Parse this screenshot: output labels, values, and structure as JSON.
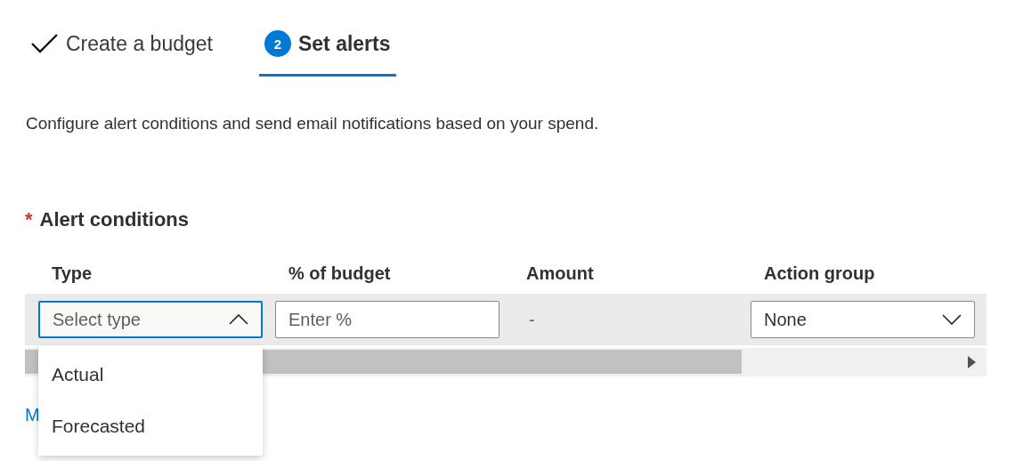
{
  "steps": [
    {
      "label": "Create a budget",
      "kind": "done",
      "selected": false
    },
    {
      "label": "Set alerts",
      "number": "2",
      "kind": "current",
      "selected": true
    }
  ],
  "description": "Configure alert conditions and send email notifications based on your spend.",
  "section": {
    "title": "Alert conditions",
    "required": true,
    "required_mark": "*"
  },
  "table": {
    "columns": [
      "Type",
      "% of budget",
      "Amount",
      "Action group"
    ],
    "row": {
      "type": {
        "placeholder": "Select type",
        "expanded": true,
        "options": [
          "Actual",
          "Forecasted"
        ]
      },
      "percent": {
        "placeholder": "Enter %"
      },
      "amount": "-",
      "action_group": {
        "value": "None",
        "expanded": false
      }
    }
  },
  "link": "M"
}
